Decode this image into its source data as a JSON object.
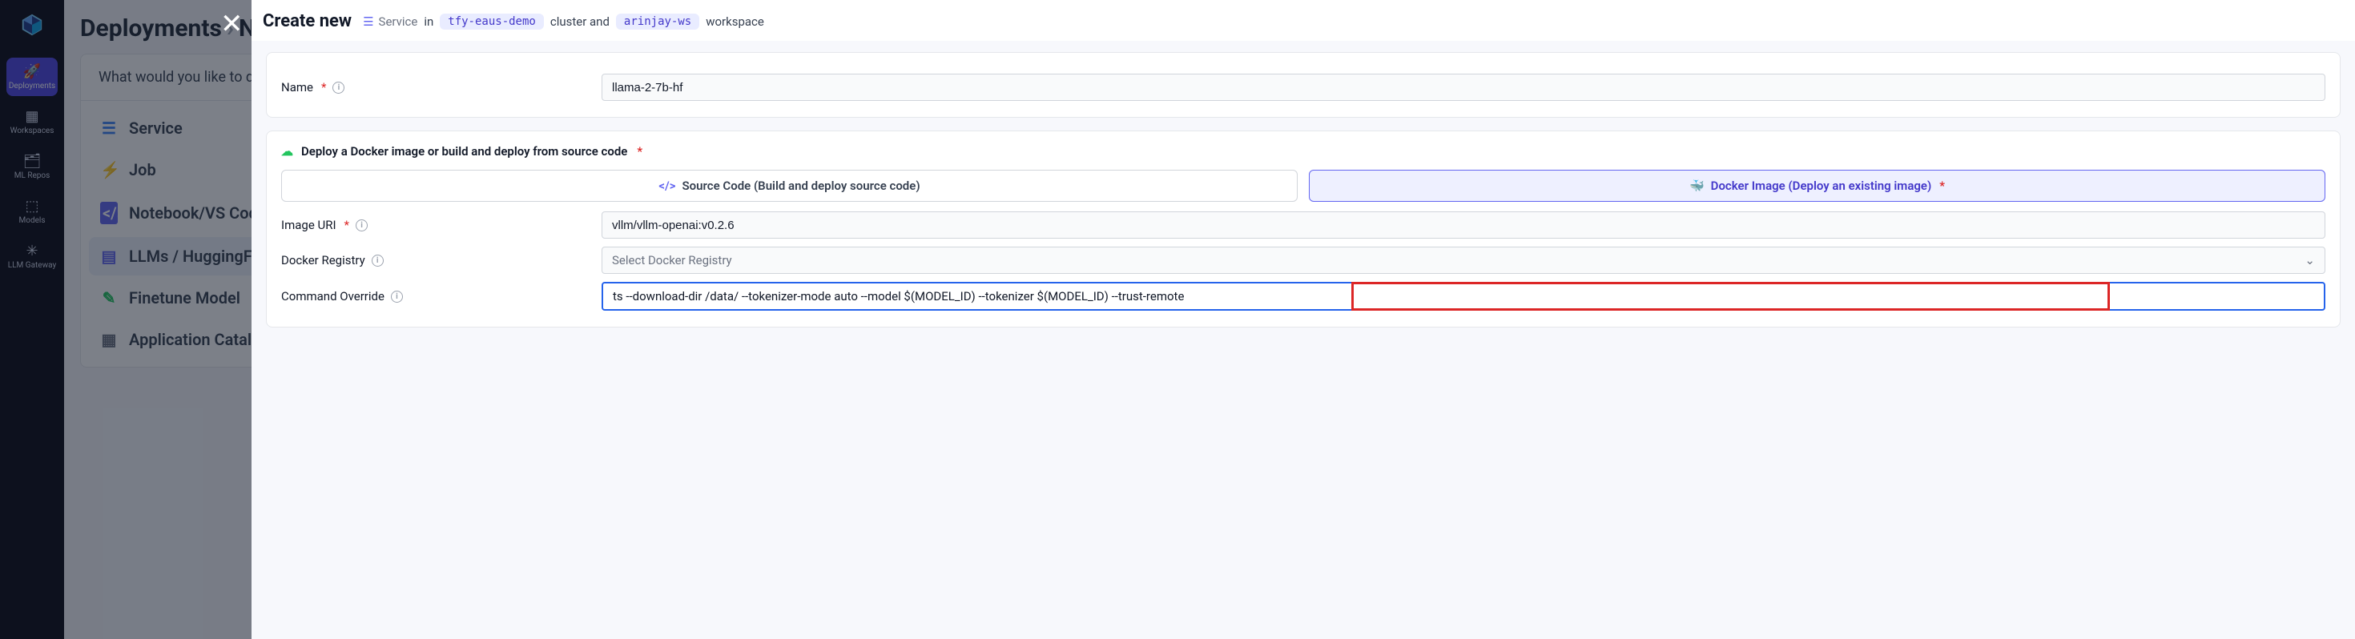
{
  "nav": {
    "items": [
      {
        "label": "Deployments"
      },
      {
        "label": "Workspaces"
      },
      {
        "label": "ML Repos"
      },
      {
        "label": "Models"
      },
      {
        "label": "LLM Gateway"
      }
    ]
  },
  "bg": {
    "crumb1": "Deployments",
    "crumb2": "Ne",
    "question": "What would you like to de",
    "options": [
      {
        "label": "Service"
      },
      {
        "label": "Job"
      },
      {
        "label": "Notebook/VS Code"
      },
      {
        "label": "LLMs / HuggingFace M"
      },
      {
        "label": "Finetune Model"
      },
      {
        "label": "Application Catalogue"
      }
    ]
  },
  "modal": {
    "title": "Create new",
    "svc_label": "Service",
    "in_word": "in",
    "cluster_pill": "tfy-eaus-demo",
    "cluster_word": "cluster and",
    "ws_pill": "arinjay-ws",
    "ws_word": "workspace",
    "name_label": "Name",
    "name_value": "llama-2-7b-hf",
    "deploy_section_title": "Deploy a Docker image or build and deploy from source code",
    "seg_source_label": "Source Code (Build and deploy source code)",
    "seg_docker_label": "Docker Image (Deploy an existing image)",
    "image_uri_label": "Image URI",
    "image_uri_value": "vllm/vllm-openai:v0.2.6",
    "registry_label": "Docker Registry",
    "registry_placeholder": "Select Docker Registry",
    "cmd_label": "Command Override",
    "cmd_value": "ts --download-dir /data/ --tokenizer-mode auto --model $(MODEL_ID) --tokenizer $(MODEL_ID) --trust-remote"
  }
}
